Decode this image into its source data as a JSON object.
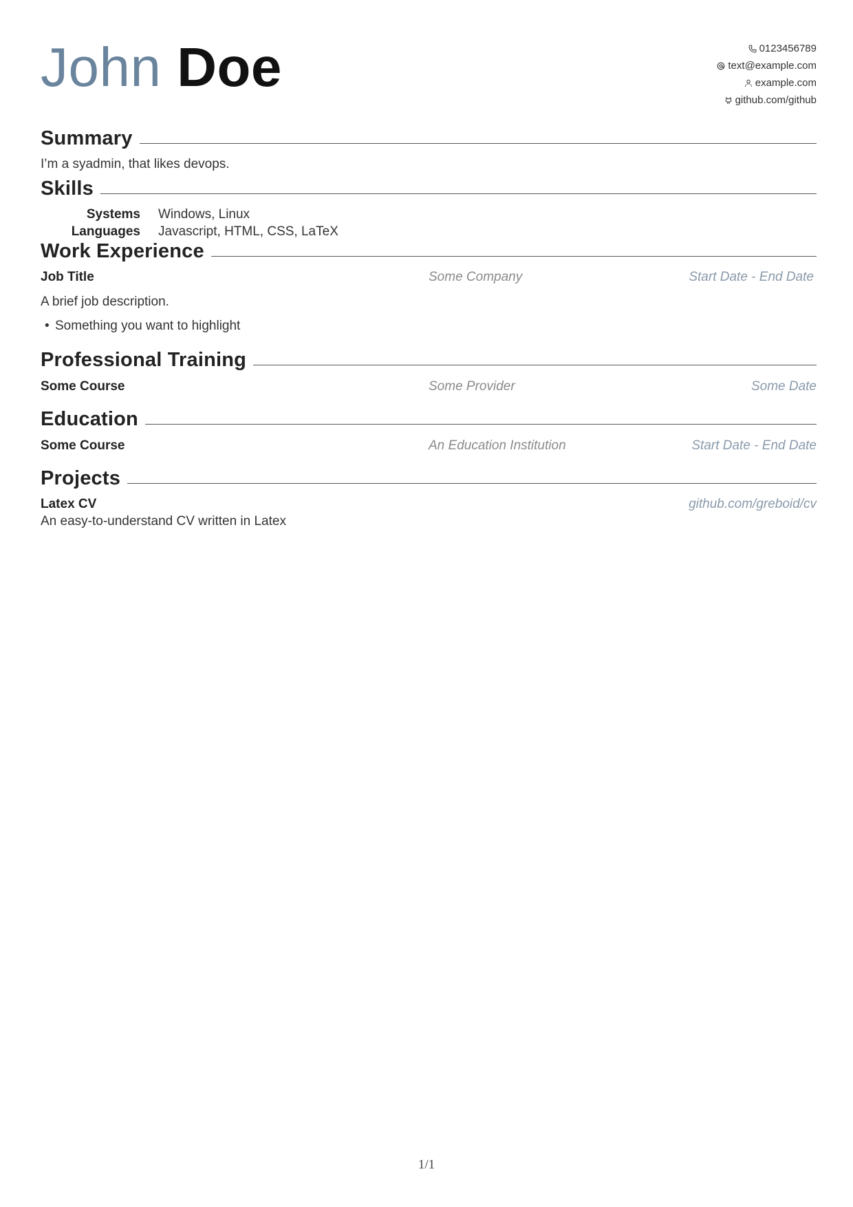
{
  "header": {
    "first_name": "John",
    "last_name": "Doe",
    "contact": {
      "phone": "0123456789",
      "email": "text@example.com",
      "website": "example.com",
      "github": "github.com/github"
    }
  },
  "summary": {
    "heading": "Summary",
    "text": "I’m a syadmin, that likes devops."
  },
  "skills": {
    "heading": "Skills",
    "items": [
      {
        "category": "Systems",
        "value": "Windows, Linux"
      },
      {
        "category": "Languages",
        "value": "Javascript, HTML, CSS, LaTeX"
      }
    ]
  },
  "work": {
    "heading": "Work Experience",
    "job_title": "Job Title",
    "company": "Some Company",
    "dates": "Start Date - End Date",
    "description": "A brief job description.",
    "highlights": [
      "Something you want to highlight"
    ]
  },
  "training": {
    "heading": "Professional Training",
    "course": "Some Course",
    "provider": "Some Provider",
    "date": "Some Date"
  },
  "education": {
    "heading": "Education",
    "course": "Some Course",
    "institution": "An Education Institution",
    "dates": "Start Date - End Date"
  },
  "projects": {
    "heading": "Projects",
    "name": "Latex CV",
    "link": "github.com/greboid/cv",
    "description": "An easy-to-understand CV written in Latex"
  },
  "footer": {
    "page": "1/1"
  },
  "colors": {
    "first_name": "#6a849d",
    "accent_italic": "#8a9aaa",
    "rule": "#555555"
  },
  "icons": [
    "phone-icon",
    "email-icon",
    "website-icon",
    "github-icon"
  ]
}
